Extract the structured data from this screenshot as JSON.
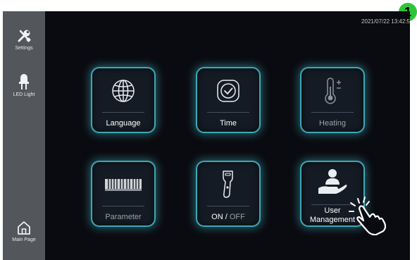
{
  "badge": {
    "number": "1"
  },
  "sidebar": {
    "items": [
      {
        "label": "Settings",
        "icon": "wrench-screwdriver-icon"
      },
      {
        "label": "LED Light",
        "icon": "led-light-icon"
      },
      {
        "label": "Main Page",
        "icon": "home-icon"
      }
    ]
  },
  "header": {
    "timestamp": "2021/07/22  13:42:5"
  },
  "tiles": [
    {
      "label": "Language",
      "icon": "globe-icon"
    },
    {
      "label": "Time",
      "icon": "clock-check-icon"
    },
    {
      "label": "Heating",
      "icon": "thermometer-icon"
    },
    {
      "label": "Parameter",
      "icon": "grid-panel-icon"
    },
    {
      "label_on": "ON",
      "label_sep": " / ",
      "label_off": "OFF",
      "icon": "handheld-scanner-icon"
    },
    {
      "label_line1": "User",
      "label_line2": "Management",
      "icon": "user-hand-icon"
    }
  ],
  "colors": {
    "accent": "#3ea7b6",
    "badge": "#2ec53a",
    "sidebar": "#53565b",
    "background": "#0a0b10"
  }
}
